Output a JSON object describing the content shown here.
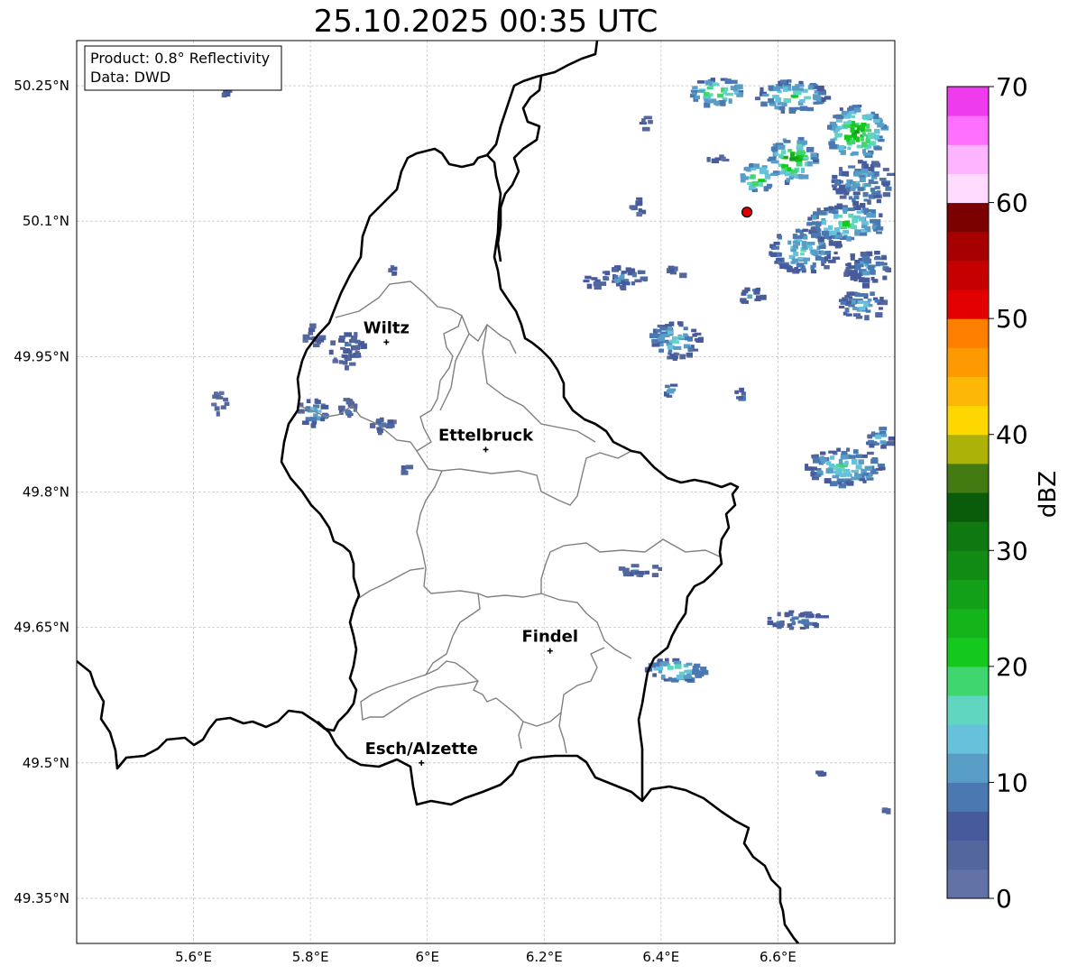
{
  "title": "25.10.2025 00:35 UTC",
  "info": {
    "product": "Product: 0.8° Reflectivity",
    "data": "Data: DWD"
  },
  "map": {
    "lon_range": [
      5.4,
      6.8
    ],
    "lat_range": [
      49.3,
      50.3
    ],
    "x_ticks": [
      {
        "value": 5.6,
        "label": "5.6°E"
      },
      {
        "value": 5.8,
        "label": "5.8°E"
      },
      {
        "value": 6.0,
        "label": "6°E"
      },
      {
        "value": 6.2,
        "label": "6.2°E"
      },
      {
        "value": 6.4,
        "label": "6.4°E"
      },
      {
        "value": 6.6,
        "label": "6.6°E"
      }
    ],
    "y_ticks": [
      {
        "value": 50.25,
        "label": "50.25°N"
      },
      {
        "value": 50.1,
        "label": "50.1°N"
      },
      {
        "value": 49.95,
        "label": "49.95°N"
      },
      {
        "value": 49.8,
        "label": "49.8°N"
      },
      {
        "value": 49.65,
        "label": "49.65°N"
      },
      {
        "value": 49.5,
        "label": "49.5°N"
      },
      {
        "value": 49.35,
        "label": "49.35°N"
      }
    ],
    "grid": true,
    "cities": [
      {
        "name": "Wiltz",
        "lon": 5.93,
        "lat": 49.966
      },
      {
        "name": "Ettelbruck",
        "lon": 6.1,
        "lat": 49.847
      },
      {
        "name": "Findel",
        "lon": 6.21,
        "lat": 49.624
      },
      {
        "name": "Esch/Alzette",
        "lon": 5.99,
        "lat": 49.5
      }
    ],
    "radar_site": {
      "lon": 6.547,
      "lat": 50.11,
      "color": "#e00000"
    }
  },
  "colorbar": {
    "label": "dBZ",
    "min": 0,
    "max": 70,
    "ticks": [
      {
        "value": 0,
        "label": "0"
      },
      {
        "value": 10,
        "label": "10"
      },
      {
        "value": 20,
        "label": "20"
      },
      {
        "value": 30,
        "label": "30"
      },
      {
        "value": 40,
        "label": "40"
      },
      {
        "value": 50,
        "label": "50"
      },
      {
        "value": 60,
        "label": "60"
      },
      {
        "value": 70,
        "label": "70"
      }
    ],
    "colors": [
      "#6272a6",
      "#53679e",
      "#465a9c",
      "#4a78b0",
      "#589dc6",
      "#66c1da",
      "#60d5c0",
      "#3fd56f",
      "#14c81e",
      "#12b41a",
      "#13a019",
      "#118b13",
      "#0f7810",
      "#0a5c0a",
      "#437a12",
      "#adb208",
      "#fed700",
      "#fdb707",
      "#fd9a02",
      "#fe7e00",
      "#e20000",
      "#c50000",
      "#a60000",
      "#7b0000",
      "#ffdcff",
      "#ffb4ff",
      "#ff70ff",
      "#ed3bed"
    ]
  },
  "reflectivity_cells": [
    {
      "lon": 6.49,
      "lat": 50.245,
      "w": 0.09,
      "h": 0.03,
      "dbz": 22
    },
    {
      "lon": 6.62,
      "lat": 50.24,
      "w": 0.12,
      "h": 0.035,
      "dbz": 18
    },
    {
      "lon": 6.73,
      "lat": 50.2,
      "w": 0.1,
      "h": 0.06,
      "dbz": 24
    },
    {
      "lon": 6.62,
      "lat": 50.17,
      "w": 0.08,
      "h": 0.05,
      "dbz": 26
    },
    {
      "lon": 6.56,
      "lat": 50.15,
      "w": 0.06,
      "h": 0.03,
      "dbz": 22
    },
    {
      "lon": 6.74,
      "lat": 50.145,
      "w": 0.1,
      "h": 0.05,
      "dbz": 12
    },
    {
      "lon": 6.71,
      "lat": 50.1,
      "w": 0.14,
      "h": 0.04,
      "dbz": 18
    },
    {
      "lon": 6.64,
      "lat": 50.07,
      "w": 0.12,
      "h": 0.05,
      "dbz": 14
    },
    {
      "lon": 6.75,
      "lat": 50.05,
      "w": 0.08,
      "h": 0.04,
      "dbz": 10
    },
    {
      "lon": 6.74,
      "lat": 50.01,
      "w": 0.08,
      "h": 0.03,
      "dbz": 12
    },
    {
      "lon": 6.42,
      "lat": 49.97,
      "w": 0.09,
      "h": 0.04,
      "dbz": 14
    },
    {
      "lon": 6.33,
      "lat": 50.04,
      "w": 0.08,
      "h": 0.025,
      "dbz": 8
    },
    {
      "lon": 6.42,
      "lat": 50.045,
      "w": 0.03,
      "h": 0.015,
      "dbz": 6
    },
    {
      "lon": 6.28,
      "lat": 50.035,
      "w": 0.03,
      "h": 0.015,
      "dbz": 6
    },
    {
      "lon": 6.55,
      "lat": 50.02,
      "w": 0.04,
      "h": 0.02,
      "dbz": 10
    },
    {
      "lon": 6.71,
      "lat": 49.83,
      "w": 0.13,
      "h": 0.04,
      "dbz": 16
    },
    {
      "lon": 6.77,
      "lat": 49.86,
      "w": 0.04,
      "h": 0.03,
      "dbz": 12
    },
    {
      "lon": 6.63,
      "lat": 49.66,
      "w": 0.1,
      "h": 0.02,
      "dbz": 8
    },
    {
      "lon": 6.42,
      "lat": 49.605,
      "w": 0.1,
      "h": 0.025,
      "dbz": 18
    },
    {
      "lon": 6.36,
      "lat": 49.715,
      "w": 0.08,
      "h": 0.012,
      "dbz": 6
    },
    {
      "lon": 5.86,
      "lat": 49.96,
      "w": 0.06,
      "h": 0.04,
      "dbz": 6
    },
    {
      "lon": 5.8,
      "lat": 49.975,
      "w": 0.03,
      "h": 0.025,
      "dbz": 5
    },
    {
      "lon": 5.8,
      "lat": 49.89,
      "w": 0.05,
      "h": 0.03,
      "dbz": 12
    },
    {
      "lon": 5.86,
      "lat": 49.895,
      "w": 0.04,
      "h": 0.02,
      "dbz": 6
    },
    {
      "lon": 5.92,
      "lat": 49.875,
      "w": 0.04,
      "h": 0.02,
      "dbz": 6
    },
    {
      "lon": 5.64,
      "lat": 49.9,
      "w": 0.025,
      "h": 0.025,
      "dbz": 5
    },
    {
      "lon": 5.94,
      "lat": 50.045,
      "w": 0.02,
      "h": 0.015,
      "dbz": 5
    },
    {
      "lon": 6.36,
      "lat": 50.12,
      "w": 0.03,
      "h": 0.02,
      "dbz": 5
    },
    {
      "lon": 6.37,
      "lat": 50.21,
      "w": 0.02,
      "h": 0.015,
      "dbz": 5
    },
    {
      "lon": 6.49,
      "lat": 50.17,
      "w": 0.03,
      "h": 0.01,
      "dbz": 5
    },
    {
      "lon": 6.41,
      "lat": 49.915,
      "w": 0.02,
      "h": 0.015,
      "dbz": 10
    },
    {
      "lon": 6.53,
      "lat": 49.91,
      "w": 0.02,
      "h": 0.015,
      "dbz": 10
    },
    {
      "lon": 5.96,
      "lat": 49.828,
      "w": 0.02,
      "h": 0.012,
      "dbz": 5
    },
    {
      "lon": 5.65,
      "lat": 50.245,
      "w": 0.01,
      "h": 0.01,
      "dbz": 5
    },
    {
      "lon": 6.67,
      "lat": 49.492,
      "w": 0.015,
      "h": 0.008,
      "dbz": 5
    },
    {
      "lon": 6.78,
      "lat": 49.448,
      "w": 0.015,
      "h": 0.006,
      "dbz": 5
    }
  ]
}
